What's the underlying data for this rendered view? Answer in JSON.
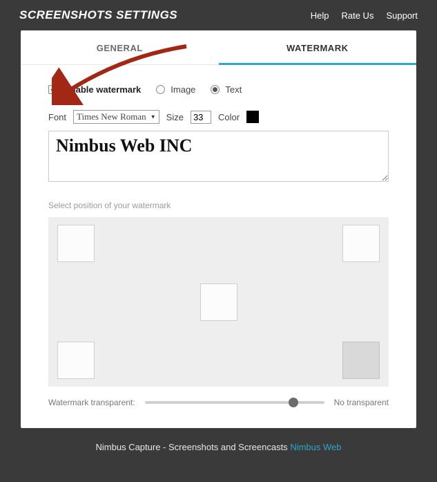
{
  "header": {
    "title": "SCREENSHOTS SETTINGS",
    "links": {
      "help": "Help",
      "rate": "Rate Us",
      "support": "Support"
    }
  },
  "tabs": {
    "general": "GENERAL",
    "watermark": "WATERMARK"
  },
  "enable": {
    "label": "Enable watermark",
    "checked": true
  },
  "type": {
    "image": {
      "label": "Image",
      "selected": false
    },
    "text": {
      "label": "Text",
      "selected": true
    }
  },
  "font": {
    "label": "Font",
    "value": "Times New Roman"
  },
  "size": {
    "label": "Size",
    "value": "33"
  },
  "color": {
    "label": "Color",
    "value": "#000000"
  },
  "watermark_text": "Nimbus Web INC",
  "position": {
    "label": "Select position of your watermark",
    "selected": "br"
  },
  "transparency": {
    "label": "Watermark transparent:",
    "right_label": "No transparent",
    "value": 83
  },
  "footer": {
    "text": "Nimbus Capture - Screenshots and Screencasts ",
    "link": "Nimbus Web"
  }
}
